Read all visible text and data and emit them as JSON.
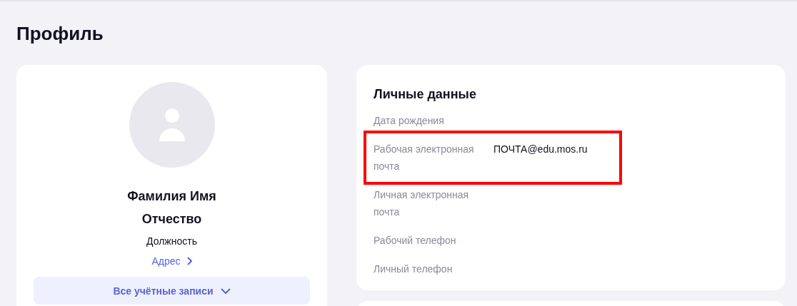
{
  "page": {
    "title": "Профиль"
  },
  "profile_card": {
    "name_line_1": "Фамилия Имя",
    "name_line_2": "Отчество",
    "position": "Должность",
    "address_link": "Адрес",
    "accounts_button": "Все учётные записи"
  },
  "personal_data": {
    "title": "Личные данные",
    "rows": [
      {
        "label": "Дата рождения",
        "highlighted": false
      },
      {
        "label": "Рабочая электронная почта",
        "value": "ПОЧТА@edu.mos.ru",
        "highlighted": true
      },
      {
        "label": "Личная электронная почта",
        "highlighted": false
      },
      {
        "label": "Рабочий телефон",
        "highlighted": false
      },
      {
        "label": "Личный телефон",
        "highlighted": false
      }
    ]
  }
}
